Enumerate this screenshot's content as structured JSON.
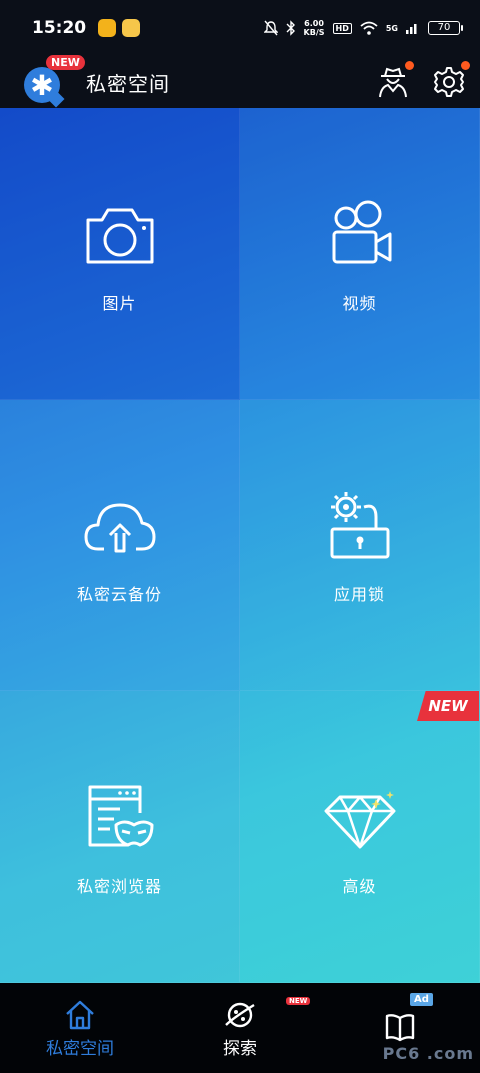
{
  "status_bar": {
    "time": "15:20",
    "net_speed_value": "6.00",
    "net_speed_unit": "KB/S",
    "hd_label": "HD",
    "network_label": "5G",
    "battery_level": "70"
  },
  "header": {
    "title": "私密空间",
    "logo_badge": "NEW"
  },
  "tiles": [
    {
      "label": "图片",
      "icon": "camera-icon"
    },
    {
      "label": "视频",
      "icon": "video-camera-icon"
    },
    {
      "label": "私密云备份",
      "icon": "cloud-upload-icon"
    },
    {
      "label": "应用锁",
      "icon": "app-lock-icon"
    },
    {
      "label": "私密浏览器",
      "icon": "incognito-browser-icon"
    },
    {
      "label": "高级",
      "icon": "diamond-icon",
      "badge": "NEW"
    }
  ],
  "bottom_nav": {
    "items": [
      {
        "label": "私密空间",
        "icon": "home-icon",
        "active": true
      },
      {
        "label": "探索",
        "icon": "planet-icon",
        "badge": "NEW"
      },
      {
        "label": "",
        "icon": "book-icon",
        "badge": "Ad"
      }
    ]
  },
  "watermark": "PC6 .com",
  "colors": {
    "accent": "#2f7ddc",
    "new_badge": "#e8323c",
    "notification_dot": "#ff5a1f"
  }
}
